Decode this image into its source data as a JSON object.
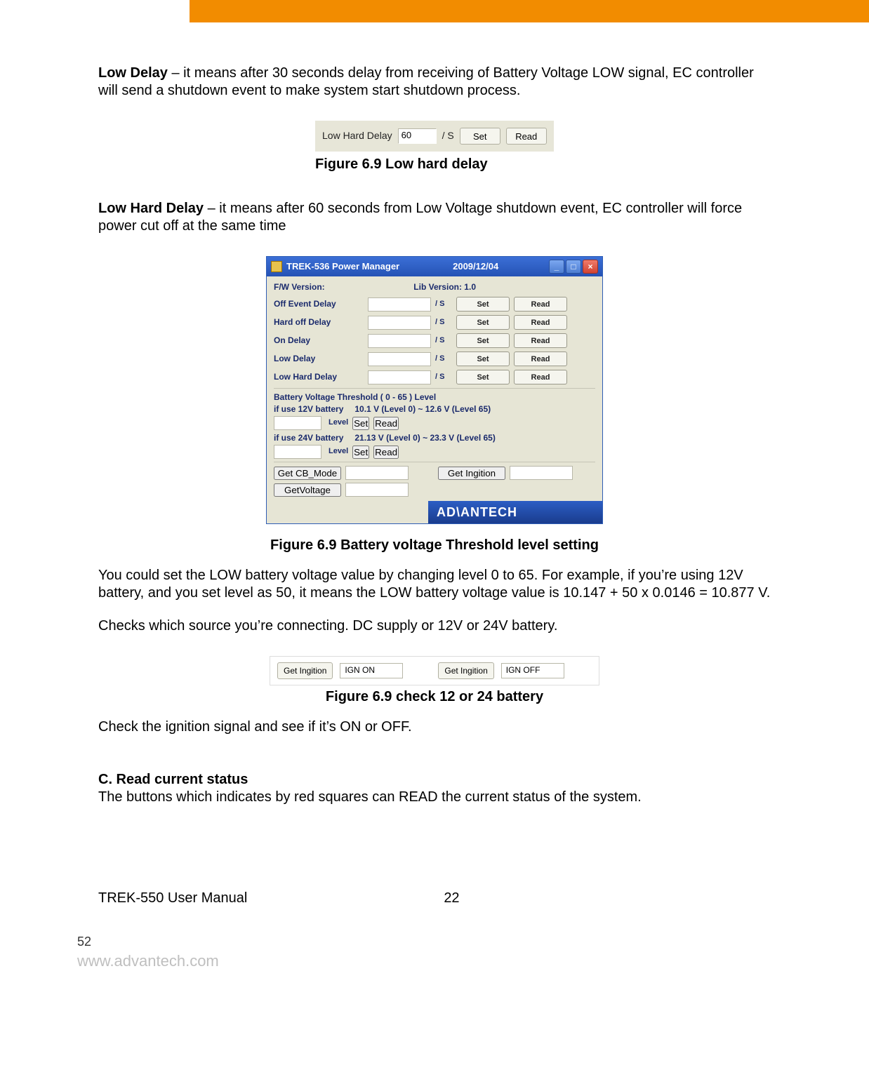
{
  "header_banner": {},
  "section_low_delay": {
    "bold": "Low Delay",
    "text": " – it means after 30 seconds delay from receiving of Battery Voltage LOW signal, EC controller will send a shutdown event to make system start shutdown process."
  },
  "fig1": {
    "label": "Low Hard  Delay",
    "value": "60",
    "unit": "/ S",
    "set": "Set",
    "read": "Read",
    "caption": "Figure 6.9 Low hard delay"
  },
  "section_low_hard_delay": {
    "bold": "Low Hard Delay",
    "text": " – it means after 60 seconds from Low Voltage shutdown event, EC controller will force power cut off at the same time"
  },
  "power_manager": {
    "title": "TREK-536 Power Manager",
    "date": "2009/12/04",
    "fw_label": "F/W Version:",
    "lib_label": "Lib Version: 1.0",
    "rows": [
      {
        "label": "Off Event  Delay",
        "val": "",
        "unit": "/ S",
        "set": "Set",
        "read": "Read"
      },
      {
        "label": "Hard off  Delay",
        "val": "",
        "unit": "/ S",
        "set": "Set",
        "read": "Read"
      },
      {
        "label": "On  Delay",
        "val": "",
        "unit": "/ S",
        "set": "Set",
        "read": "Read"
      },
      {
        "label": "Low  Delay",
        "val": "",
        "unit": "/ S",
        "set": "Set",
        "read": "Read"
      },
      {
        "label": "Low Hard  Delay",
        "val": "",
        "unit": "/ S",
        "set": "Set",
        "read": "Read"
      }
    ],
    "bv_header": "Battery Voltage Threshold  ( 0 - 65 ) Level",
    "bv12": {
      "line": "if use 12V battery",
      "range": "10.1 V (Level 0)  ~  12.6 V (Level 65)",
      "lvl": "Level",
      "set": "Set",
      "read": "Read"
    },
    "bv24": {
      "line": "if use 24V battery",
      "range": "21.13 V (Level 0)  ~  23.3 V (Level 65)",
      "lvl": "Level",
      "set": "Set",
      "read": "Read"
    },
    "get_cb": "Get CB_Mode",
    "get_ign": "Get Ingition",
    "get_v": "GetVoltage",
    "logo": "AD\\ANTECH"
  },
  "fig2_caption": "Figure 6.9 Battery voltage Threshold level setting",
  "para_level": "You could set the LOW battery voltage value by changing level 0 to 65. For example, if you’re using 12V battery, and you set level as 50, it means the LOW battery voltage value is 10.147 + 50 x 0.0146 = 10.877 V.",
  "para_checks": "Checks which source you’re connecting. DC supply or 12V or 24V battery.",
  "ign": {
    "btn1": "Get Ingition",
    "val1": "IGN ON",
    "btn2": "Get Ingition",
    "val2": "IGN OFF",
    "caption": "Figure 6.9 check 12 or 24 battery"
  },
  "para_ign": "Check the ignition signal and see if it’s ON or OFF.",
  "section_c": {
    "bold": "C. Read current status",
    "text": "The buttons which indicates by red squares can READ the current status of the system."
  },
  "footer": {
    "manual": "TREK-550 User Manual",
    "pagecenter": "22",
    "pagebl": "52",
    "url": "www.advantech.com"
  }
}
